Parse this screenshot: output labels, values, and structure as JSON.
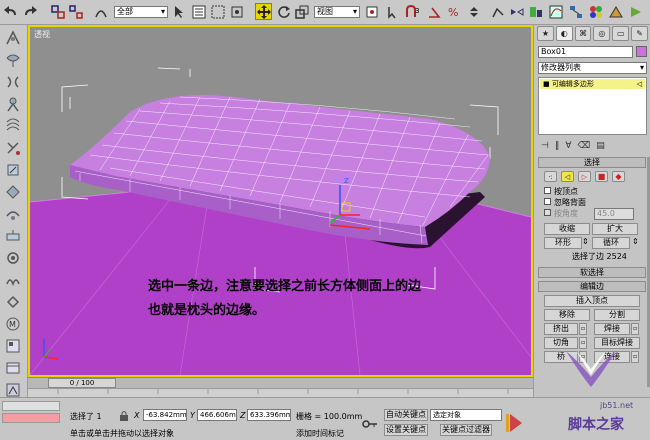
{
  "toolbar": {
    "selection_filter": "全部",
    "reference_coord": "视图"
  },
  "viewport": {
    "label": "透视",
    "caption_line1": "选中一条边，注意要选择之前长方体侧面上的边",
    "caption_line2": "也就是枕头的边缘。"
  },
  "panel": {
    "object_name": "Box01",
    "modifier_list": "修改器列表",
    "stack_item": "可编辑多边形",
    "rollout_select": "选择",
    "by_vertex": "按顶点",
    "ignore_backfacing": "忽略背面",
    "by_angle": "按角度",
    "angle_value": "45.0",
    "shrink": "收缩",
    "grow": "扩大",
    "ring": "环形",
    "loop": "循环",
    "selected_info": "选择了边 2524",
    "rollout_soft": "软选择",
    "rollout_edit_edges": "编辑边",
    "insert_vertex": "插入顶点",
    "remove": "移除",
    "split": "分割",
    "extrude": "挤出",
    "weld": "焊接",
    "chamfer": "切角",
    "target_weld": "目标焊接",
    "bridge": "桥",
    "connect": "连接"
  },
  "timeline": {
    "frame": "0 / 100"
  },
  "status": {
    "selected": "选择了 1",
    "x_label": "X",
    "x_value": "-63.842mm",
    "y_label": "Y",
    "y_value": "466.606mm",
    "z_label": "Z",
    "z_value": "633.396mm",
    "grid": "栅格 = 100.0mm",
    "auto_key": "自动关键点",
    "selection_set": "选定对象",
    "set_key": "设置关键点",
    "key_filters": "关键点过滤器",
    "prompt": "单击或单击并拖动以选择对象",
    "add_time_tag": "添加时间标记"
  },
  "watermark": {
    "site": "jb51.net",
    "name": "脚本之家"
  },
  "colors": {
    "viewport_bg": "#8f8f8f",
    "ground": "#b040c8",
    "pillow": "#c77fe0",
    "active_border": "#e8d400",
    "edge_selected": "#ff2020"
  }
}
